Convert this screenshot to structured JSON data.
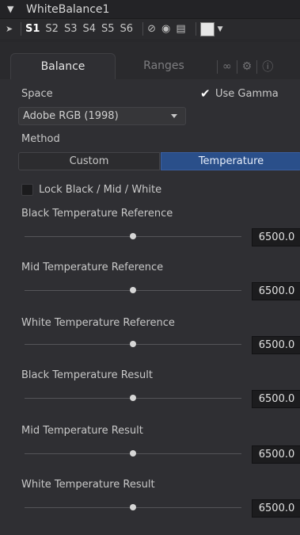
{
  "header": {
    "title": "WhiteBalance1",
    "collapse_icon": "chevron-down-icon"
  },
  "versionbar": {
    "pin_icon": "pin-icon",
    "versions": [
      "S1",
      "S2",
      "S3",
      "S4",
      "S5",
      "S6"
    ],
    "active_version": "S1",
    "disable_icon": "circle-slash-icon",
    "lock_icon": "lock-icon",
    "save_icon": "save-icon",
    "swatch_color": "#e6e6e6"
  },
  "tabs": {
    "active": "Balance",
    "inactive": "Ranges",
    "icons": [
      "link-icon",
      "gear-icon",
      "info-icon"
    ]
  },
  "space": {
    "label": "Space",
    "selected": "Adobe RGB (1998)"
  },
  "use_gamma": {
    "label": "Use Gamma",
    "checked": true
  },
  "method": {
    "label": "Method",
    "options": [
      "Custom",
      "Temperature"
    ],
    "selected": "Temperature"
  },
  "lock": {
    "label": "Lock Black / Mid / White",
    "checked": false
  },
  "sliders": [
    {
      "label": "Black Temperature Reference",
      "value": "6500.0",
      "position": 0.5
    },
    {
      "label": "Mid Temperature Reference",
      "value": "6500.0",
      "position": 0.5
    },
    {
      "label": "White Temperature Reference",
      "value": "6500.0",
      "position": 0.5
    },
    {
      "label": "Black Temperature Result",
      "value": "6500.0",
      "position": 0.5
    },
    {
      "label": "Mid Temperature Result",
      "value": "6500.0",
      "position": 0.5
    },
    {
      "label": "White Temperature Result",
      "value": "6500.0",
      "position": 0.5
    }
  ],
  "colors": {
    "accent": "#2a4f8a",
    "panel": "#2f2f33",
    "header": "#232326"
  }
}
